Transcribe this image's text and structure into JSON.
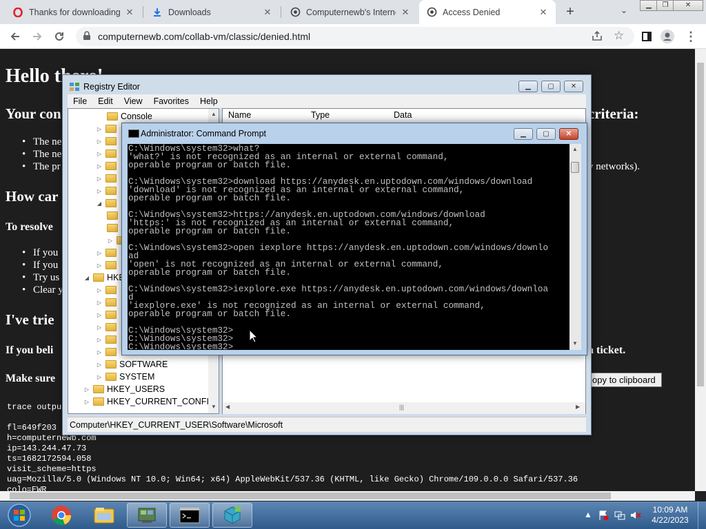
{
  "browser": {
    "tabs": [
      {
        "title": "Thanks for downloading",
        "icon": "opera-icon"
      },
      {
        "title": "Downloads",
        "icon": "download-icon"
      },
      {
        "title": "Computernewb's Interne",
        "icon": "computernewb-icon"
      },
      {
        "title": "Access Denied",
        "icon": "computernewb-icon",
        "active": true
      }
    ],
    "new_tab": "+",
    "tab_list": "⌄",
    "url": "computernewb.com/collab-vm/classic/denied.html"
  },
  "webpage": {
    "h1": "Hello there!",
    "h2_1": "Your con",
    "h2_1_tail": "criteria:",
    "bullets1": [
      "The ne",
      "The ne",
      "The pr"
    ],
    "bullets1_tail": "y networks).",
    "h2_2": "How car",
    "h3_1": "To resolve",
    "bullets2": [
      "If you",
      "If you",
      "Try us",
      "Clear y"
    ],
    "h2_3": "I've trie",
    "h3_2": "If you beli",
    "h3_2_tail": "a ticket.",
    "h3_3": "Make sure",
    "copy_button": "opy to clipboard",
    "trace_label": "trace outpu",
    "trace_lines": [
      "fl=649f203",
      "h=computernewb.com",
      "ip=143.244.47.73",
      "ts=1682172594.058",
      "visit_scheme=https",
      "uag=Mozilla/5.0 (Windows NT 10.0; Win64; x64) AppleWebKit/537.36 (KHTML, like Gecko) Chrome/109.0.0.0 Safari/537.36",
      "colo=EWR"
    ]
  },
  "regedit": {
    "title": "Registry Editor",
    "menu": [
      "File",
      "Edit",
      "View",
      "Favorites",
      "Help"
    ],
    "tree": {
      "console": "Console",
      "hkey_partial": "HKE",
      "software": "SOFTWARE",
      "system": "SYSTEM",
      "hkey_users": "HKEY_USERS",
      "hkey_current_config": "HKEY_CURRENT_CONFIG"
    },
    "columns": [
      "Name",
      "Type",
      "Data"
    ],
    "status": "Computer\\HKEY_CURRENT_USER\\Software\\Microsoft"
  },
  "cmd": {
    "title": "Administrator: Command Prompt",
    "output": "C:\\Windows\\system32>what?\n'what?' is not recognized as an internal or external command,\noperable program or batch file.\n\nC:\\Windows\\system32>download https://anydesk.en.uptodown.com/windows/download\n'download' is not recognized as an internal or external command,\noperable program or batch file.\n\nC:\\Windows\\system32>https://anydesk.en.uptodown.com/windows/download\n'https:' is not recognized as an internal or external command,\noperable program or batch file.\n\nC:\\Windows\\system32>open iexplore https://anydesk.en.uptodown.com/windows/downlo\nad\n'open' is not recognized as an internal or external command,\noperable program or batch file.\n\nC:\\Windows\\system32>iexplore.exe https://anydesk.en.uptodown.com/windows/downloa\nd\n'iexplore.exe' is not recognized as an internal or external command,\noperable program or batch file.\n\nC:\\Windows\\system32>\nC:\\Windows\\system32>\nC:\\Windows\\system32>"
  },
  "taskbar": {
    "apps": [
      "start-orb",
      "chrome-icon",
      "file-explorer-icon",
      "regedit-icon",
      "cmd-icon",
      "package-icon"
    ],
    "time": "10:09 AM",
    "date": "4/22/2023"
  },
  "colors": {
    "page_bg": "#1e1e1e",
    "console_bg": "#000000",
    "console_fg": "#c0c0c0",
    "taskbar": "#2f5b8c"
  }
}
